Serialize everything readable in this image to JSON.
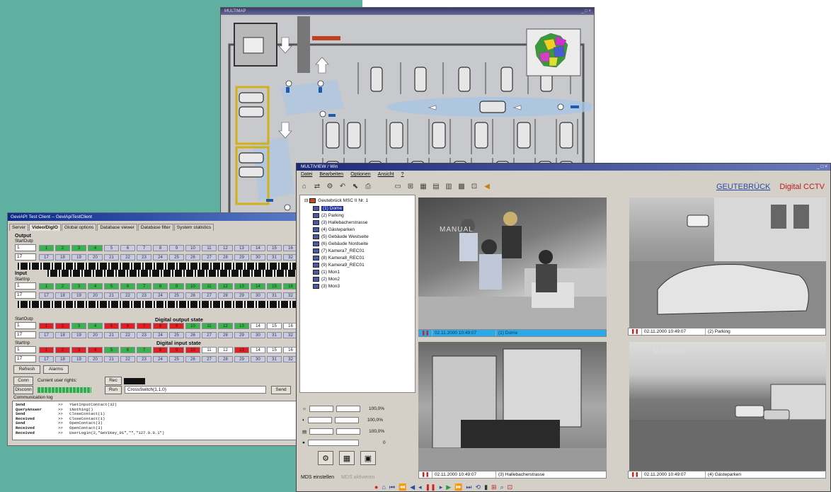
{
  "multimap": {
    "title": "MULTIMAP",
    "controls": "_ □ ×"
  },
  "geviapi": {
    "title": "GeviAPI Test Client -- GeviApiTestClient",
    "tabs": [
      "Server",
      "Video/DigIO",
      "Global options",
      "Database viewer",
      "Database filter",
      "System statistics"
    ],
    "active_tab": "Video/DigIO",
    "output_label": "Output",
    "input_label": "Input",
    "startoutp_label": "StartOutp",
    "startinp_label": "StartInp",
    "spin1": "1",
    "spin17": "17",
    "row_a": [
      "1",
      "2",
      "3",
      "4",
      "5",
      "6",
      "7",
      "8",
      "9",
      "10",
      "11",
      "12",
      "13",
      "14",
      "15",
      "16"
    ],
    "row_b": [
      "17",
      "18",
      "19",
      "20",
      "21",
      "22",
      "23",
      "24",
      "25",
      "26",
      "27",
      "28",
      "29",
      "30",
      "31",
      "32"
    ],
    "digital_output_title": "Digital output state",
    "digital_input_title": "Digital input state",
    "refresh": "Refresh",
    "alarms": "Alarms",
    "conn": "Conn",
    "disconn": "Disconn",
    "current_user_rights": "Current user rights:",
    "rec": "Rec",
    "run": "Run",
    "command": "CrossSwitch(1,1,0)",
    "send": "Send",
    "comm_log_label": "Communication log",
    "log": [
      [
        "Send",
        ">>",
        "YGetInputContact(32)"
      ],
      [
        "QueryAnswer",
        ">>",
        "1Nothing()"
      ],
      [
        "Send",
        ">>",
        "CloseContact(1)"
      ],
      [
        "Received",
        ">>",
        "CloseContact(1)"
      ],
      [
        "Send",
        ">>",
        "OpenContact(3)"
      ],
      [
        "Received",
        ">>",
        "OpenContact(3)"
      ],
      [
        "Received",
        ">>",
        "UserLogin(2,\"GeViKey_01\",\"\",\"127.0.0.1\")"
      ]
    ]
  },
  "multiview": {
    "title": "MULTIVIEW / Win",
    "controls": "_ □ ×",
    "menu": [
      "Datei",
      "Bearbeiten",
      "Optionen",
      "Ansicht",
      "?"
    ],
    "brand_1": "GEUTEBRÜCK",
    "brand_2": "Digital CCTV",
    "tree_root": "Geutebrück MSC II Nr. 1",
    "tree_items": [
      "(1) Dome",
      "(2) Parking",
      "(3) Hallebacherstrasse",
      "(4) Gästeparken",
      "(5) Gebäude Westseite",
      "(6) Gebäude Nordseite",
      "(7) Kamera7_REC01",
      "(8) Kamera8_REC01",
      "(9) Kamera9_REC01",
      "(1) Mon1",
      "(2) Mon2",
      "(3) Mon3"
    ],
    "slider_values": [
      "100,0%",
      "100,0%",
      "100,0%",
      "0"
    ],
    "mds_label": "MDS einstellen",
    "mds_disabled": "MDS aktivieren",
    "manual": "MANUAL",
    "videos": [
      {
        "time": "02.11.2000 10:49:07",
        "name": "(1) Dome"
      },
      {
        "time": "02.11.2000 10:49:07",
        "name": "(2) Parking"
      },
      {
        "time": "02.11.2000 10:49:07",
        "name": "(3) Hallebacherstrasse"
      },
      {
        "time": "02.11.2000 10:49:07",
        "name": "(4) Gästeparken"
      }
    ],
    "pause_glyph": "❚❚"
  }
}
